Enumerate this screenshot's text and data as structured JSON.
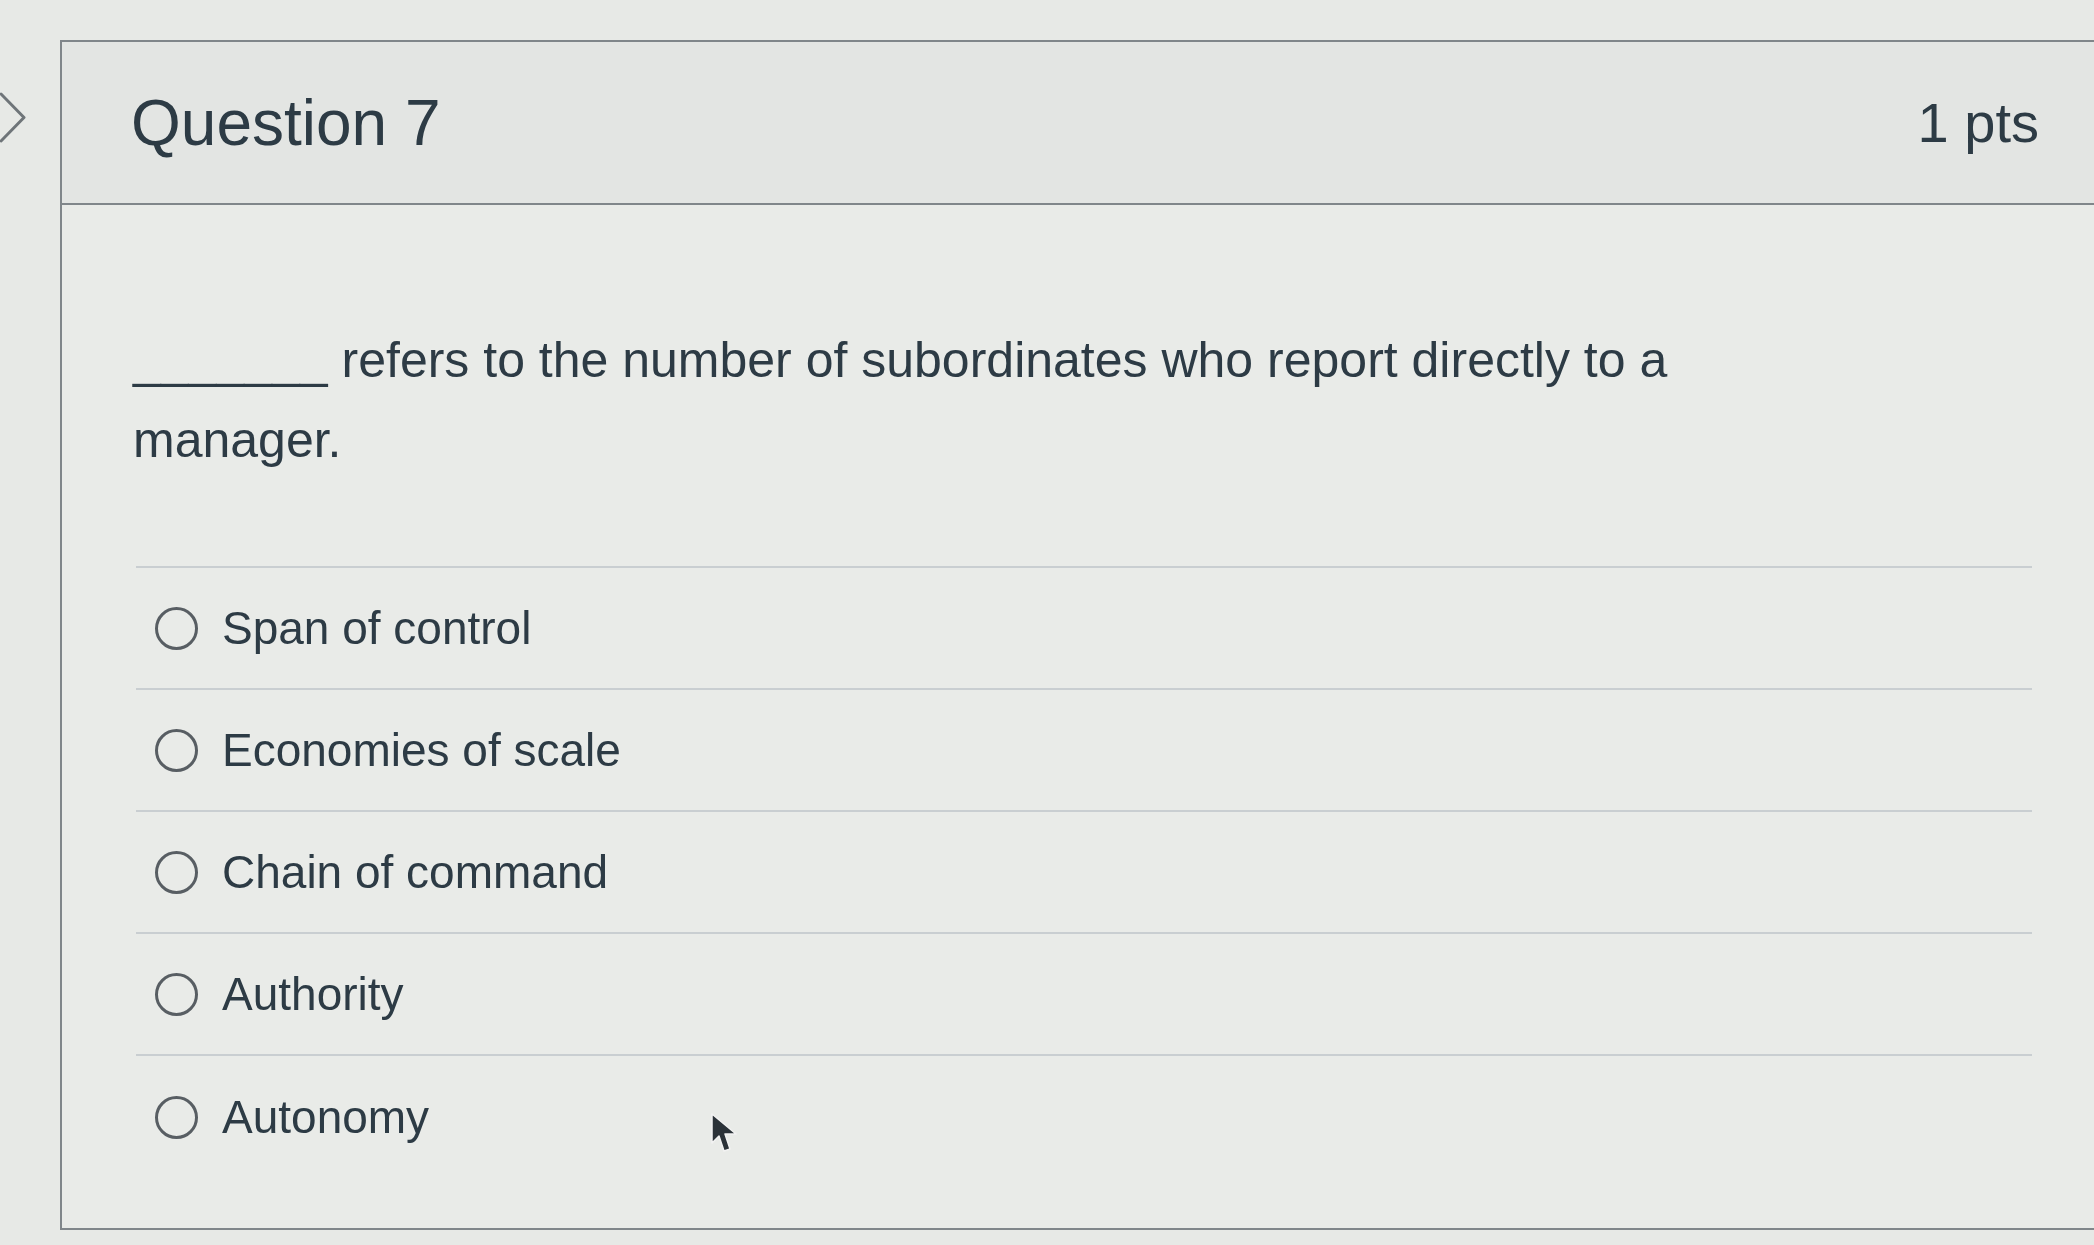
{
  "question": {
    "title": "Question 7",
    "points": "1 pts",
    "prompt": "_______ refers to the number of subordinates who report directly to a manager.",
    "options": [
      {
        "label": "Span of control",
        "selected": false
      },
      {
        "label": "Economies of scale",
        "selected": false
      },
      {
        "label": "Chain of command",
        "selected": false
      },
      {
        "label": "Authority",
        "selected": false
      },
      {
        "label": "Autonomy",
        "selected": false
      }
    ]
  }
}
